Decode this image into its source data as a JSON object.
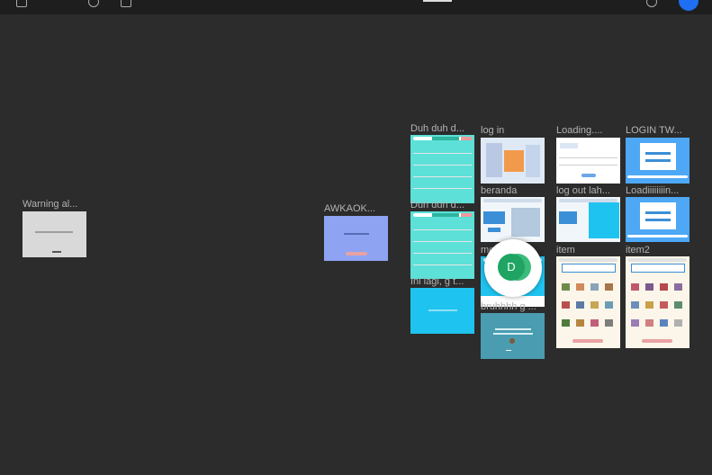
{
  "colors": {
    "canvas": "#2c2c2c",
    "toolbar": "#1e1e1e",
    "label": "#b3b3b3",
    "teal": "#5de0d8",
    "sky": "#1fc3f0",
    "blue_card": "#4ea8f5",
    "periwinkle": "#8ea3f2",
    "presence": "#1fa463"
  },
  "frames": [
    {
      "label": "Warning al...",
      "style": "warning"
    },
    {
      "label": "AWKAOK...",
      "style": "periwinkle"
    },
    {
      "label": "Duh duh d...",
      "style": "list"
    },
    {
      "label": "Duh duh d...",
      "style": "list"
    },
    {
      "label": "Ini lagi, g t...",
      "style": "sky"
    },
    {
      "label": "log in",
      "style": "illustration"
    },
    {
      "label": "beranda",
      "style": "market"
    },
    {
      "label": "me",
      "style": "sky"
    },
    {
      "label": "bruhhhh g ...",
      "style": "teal_card"
    },
    {
      "label": "Loading....",
      "style": "loading"
    },
    {
      "label": "log out lah...",
      "style": "market"
    },
    {
      "label": "item",
      "style": "catalog"
    },
    {
      "label": "LOGIN TW...",
      "style": "login"
    },
    {
      "label": "Loadiiiiiiiin...",
      "style": "login"
    },
    {
      "label": "item2",
      "style": "catalog"
    }
  ],
  "presence": {
    "initial": "D"
  }
}
